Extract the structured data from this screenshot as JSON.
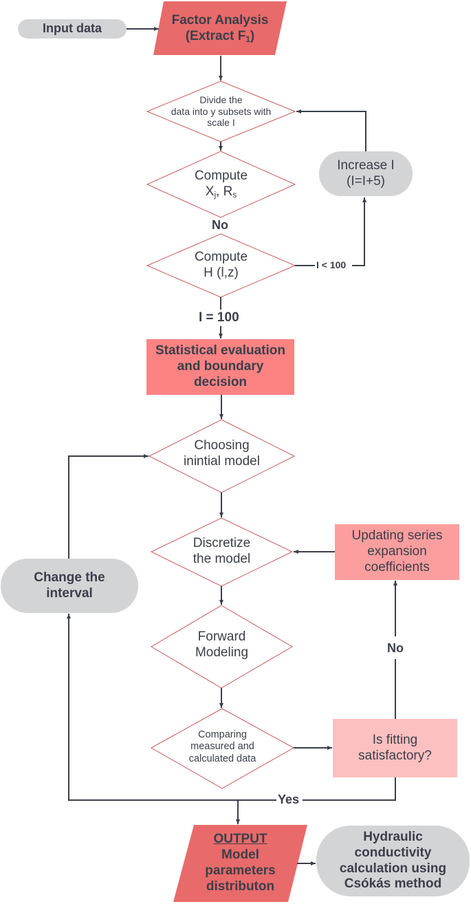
{
  "colors": {
    "process_dark": "#e96a6a",
    "process_mid": "#fd8383",
    "process_light": "#fd9e9e",
    "process_pale": "#fdc0c0",
    "terminal": "#d3d4d6",
    "decision_stroke": "#c85a5a",
    "connector": "#3a3f4b",
    "text": "#3a3f4b"
  },
  "nodes": {
    "input_data": {
      "label": "Input data"
    },
    "factor_analysis": {
      "line1": "Factor Analysis",
      "line2_prefix": "(Extract F",
      "line2_sub": "1",
      "line2_suffix": ")"
    },
    "divide_data": {
      "line1": "Divide the",
      "line2": "data into y subsets with",
      "line3": "scale I"
    },
    "compute_xr": {
      "line1": "Compute",
      "x": "X",
      "x_sub": "j",
      "sep": ", R",
      "r_sub": "s"
    },
    "compute_h": {
      "line1": "Compute",
      "line2": "H (l,z)"
    },
    "increase_i": {
      "line1": "Increase I",
      "line2": "(I=I+5)"
    },
    "statistical_eval": {
      "line1": "Statistical evaluation",
      "line2": "and boundary",
      "line3": "decision"
    },
    "choosing_model": {
      "line1": "Choosing",
      "line2": "inintial model"
    },
    "discretize": {
      "line1": "Discretize",
      "line2": "the model"
    },
    "updating_coeffs": {
      "line1": "Updating series",
      "line2": "expansion",
      "line3": "coefficients"
    },
    "change_interval": {
      "line1": "Change the",
      "line2": "interval"
    },
    "forward_modeling": {
      "line1": "Forward",
      "line2": "Modeling"
    },
    "comparing": {
      "line1": "Comparing",
      "line2": "measured and",
      "line3": "calculated data"
    },
    "is_fitting": {
      "line1": "Is fitting",
      "line2": "satisfactory?"
    },
    "output": {
      "heading": "OUTPUT",
      "line1": "Model",
      "line2": "parameters",
      "line3": "distributon"
    },
    "hydraulic": {
      "line1": "Hydraulic",
      "line2": "conductivity",
      "line3": "calculation using",
      "line4": "Csókás method"
    }
  },
  "edge_labels": {
    "no_top": "No",
    "i_less_100": "I < 100",
    "i_equals_100": "I = 100",
    "no_right": "No",
    "yes": "Yes"
  }
}
